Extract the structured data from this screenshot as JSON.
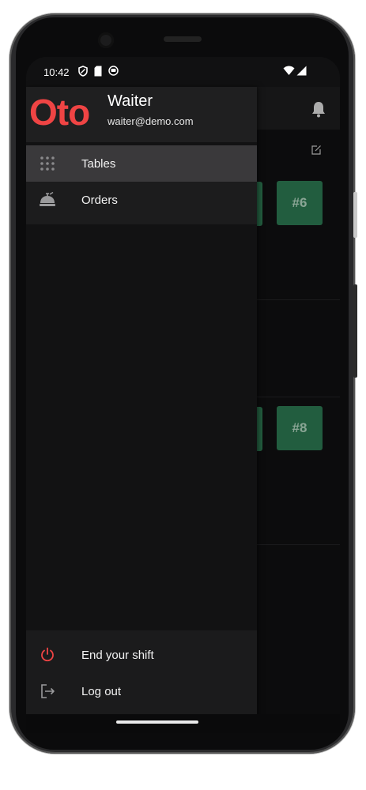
{
  "status_bar": {
    "time": "10:42",
    "left_icons": [
      "shield-icon",
      "sim-card-icon",
      "notification-icon"
    ],
    "right_icons": [
      "wifi-icon",
      "signal-icon"
    ]
  },
  "background_app": {
    "toolbar_icon": "bell-icon",
    "edit_icon": "edit-icon",
    "tables": [
      {
        "label": "#6"
      },
      {
        "label": "#8"
      }
    ]
  },
  "drawer": {
    "logo_text": "Oto",
    "user_name": "Waiter",
    "user_email": "waiter@demo.com",
    "menu": [
      {
        "label": "Tables",
        "icon": "grid-dots-icon",
        "active": true
      },
      {
        "label": "Orders",
        "icon": "food-tray-icon",
        "active": false
      }
    ],
    "footer": [
      {
        "label": "End your shift",
        "icon": "power-icon"
      },
      {
        "label": "Log out",
        "icon": "logout-icon"
      }
    ]
  },
  "colors": {
    "brand": "#ef4444",
    "table_card": "#2e7d55",
    "drawer_bg": "#121213",
    "active_item_bg": "#3a393b",
    "power_icon": "#ef4444"
  }
}
